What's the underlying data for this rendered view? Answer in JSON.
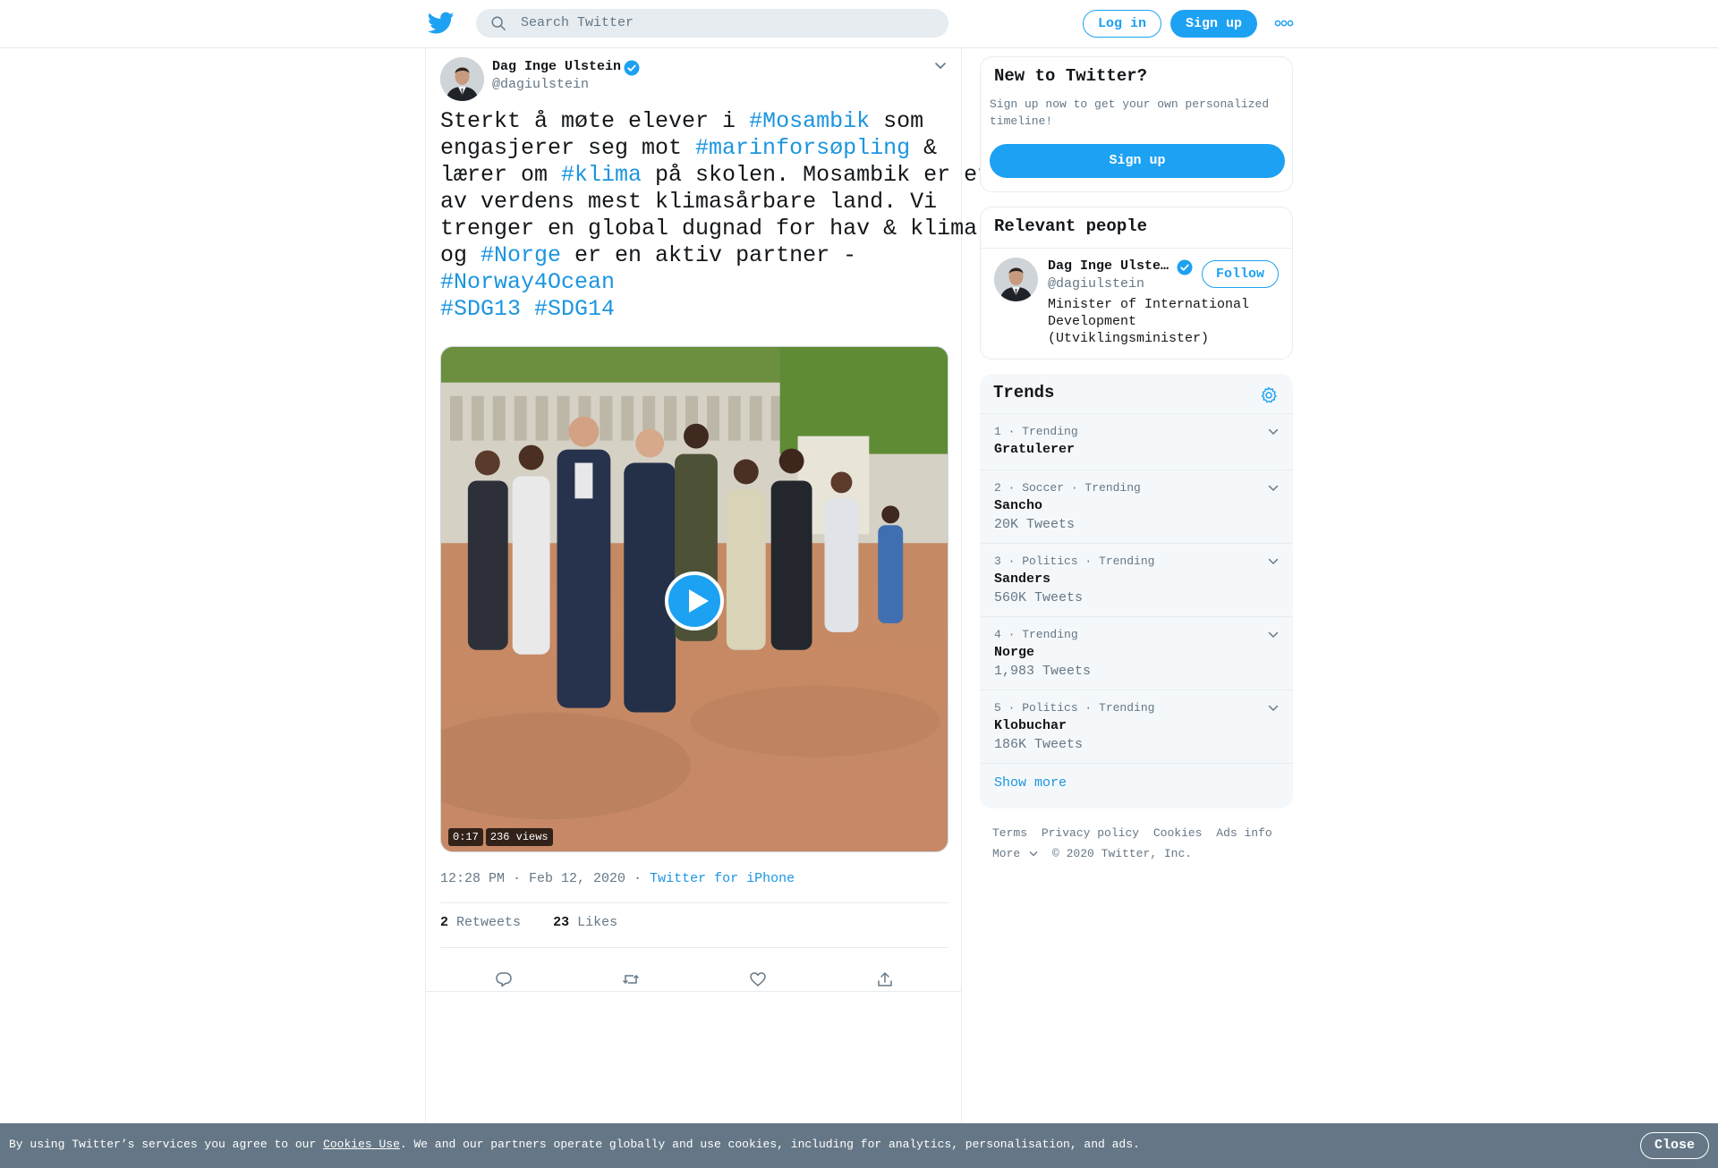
{
  "header": {
    "search_placeholder": "Search Twitter",
    "login_label": "Log in",
    "signup_label": "Sign up",
    "logo_icon": "twitter-bird-icon",
    "more_icon": "more-dots-icon"
  },
  "tweet": {
    "author_name": "Dag Inge Ulstein",
    "author_handle": "@dagiulstein",
    "text_lines": [
      [
        {
          "t": "Sterkt å møte elever i "
        },
        {
          "t": "#Mosambik",
          "h": true
        },
        {
          "t": " som"
        }
      ],
      [
        {
          "t": "engasjerer seg mot "
        },
        {
          "t": "#marinforsøpling",
          "h": true
        },
        {
          "t": " &"
        }
      ],
      [
        {
          "t": "lærer om "
        },
        {
          "t": "#klima",
          "h": true
        },
        {
          "t": " på skolen. Mosambik er et"
        }
      ],
      [
        {
          "t": "av verdens mest klimasårbare land. Vi"
        }
      ],
      [
        {
          "t": "trenger en global dugnad for hav & klima"
        }
      ],
      [
        {
          "t": "og "
        },
        {
          "t": "#Norge",
          "h": true
        },
        {
          "t": " er en aktiv partner -"
        }
      ],
      [
        {
          "t": "#Norway4Ocean",
          "h": true
        }
      ],
      [
        {
          "t": "#SDG13",
          "h": true
        },
        {
          "t": " "
        },
        {
          "t": "#SDG14",
          "h": true
        }
      ]
    ],
    "video_duration": "0:17",
    "video_views": "236 views",
    "time": "12:28 PM",
    "date": "Feb 12, 2020",
    "source": "Twitter for iPhone",
    "retweets_count": "2",
    "retweets_label": "Retweets",
    "likes_count": "23",
    "likes_label": "Likes"
  },
  "sidebar": {
    "new_to_twitter": {
      "title": "New to Twitter?",
      "subtitle_lines": [
        "Sign up now to get your own personalized",
        "timeline!"
      ],
      "button_label": "Sign up"
    },
    "relevant_people": {
      "title": "Relevant people",
      "name": "Dag Inge Ulste…",
      "handle": "@dagiulstein",
      "bio_lines": [
        "Minister of International",
        "Development",
        "(Utviklingsminister)"
      ],
      "follow_label": "Follow"
    },
    "trends": {
      "title": "Trends",
      "items": [
        {
          "context": "1 · Trending",
          "name": "Gratulerer",
          "count": ""
        },
        {
          "context": "2 · Soccer · Trending",
          "name": "Sancho",
          "count": "20K Tweets"
        },
        {
          "context": "3 · Politics · Trending",
          "name": "Sanders",
          "count": "560K Tweets"
        },
        {
          "context": "4 · Trending",
          "name": "Norge",
          "count": "1,983 Tweets"
        },
        {
          "context": "5 · Politics · Trending",
          "name": "Klobuchar",
          "count": "186K Tweets"
        }
      ],
      "show_more": "Show more"
    },
    "footer": {
      "links": [
        "Terms",
        "Privacy policy",
        "Cookies",
        "Ads info"
      ],
      "more": "More",
      "copyright": "© 2020 Twitter, Inc."
    }
  },
  "cookie_bar": {
    "text_before": "By using Twitter’s services you agree to our ",
    "link": "Cookies Use",
    "text_after": ". We and our partners operate globally and use cookies, including for analytics, personalisation, and ads.",
    "close_label": "Close"
  },
  "colors": {
    "accent": "#1da1f2",
    "link": "#1b95e0",
    "secondary_text": "#657786",
    "cookie_bar_bg": "#657786"
  }
}
